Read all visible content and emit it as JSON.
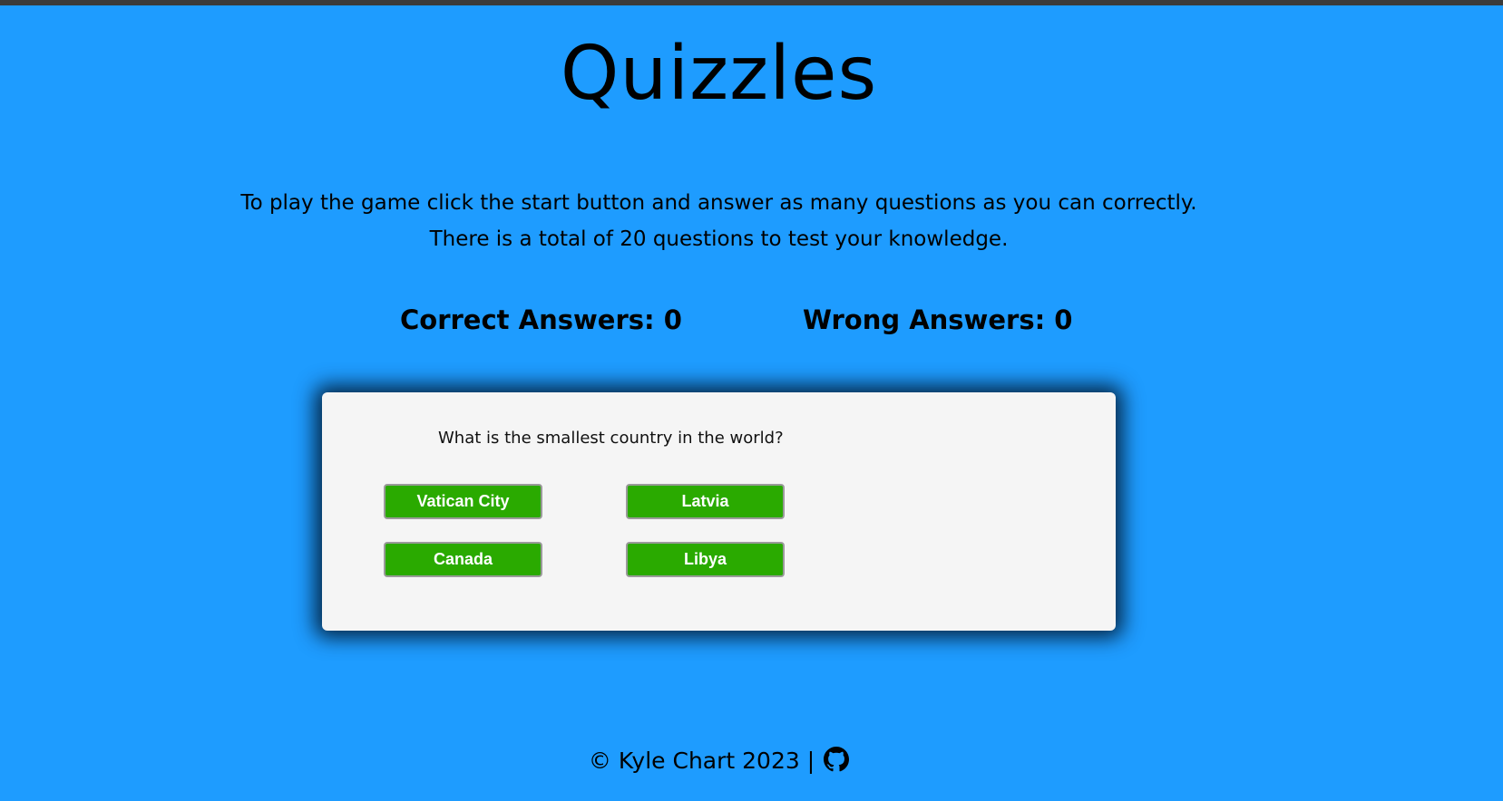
{
  "app": {
    "title": "Quizzles"
  },
  "instructions": {
    "line1": "To play the game click the start button and answer as many questions as you can correctly.",
    "line2": "There is a total of 20 questions to test your knowledge."
  },
  "scores": {
    "correct_label": "Correct Answers: 0",
    "wrong_label": "Wrong Answers: 0",
    "correct_count": 0,
    "wrong_count": 0
  },
  "quiz": {
    "question": "What is the smallest country in the world?",
    "answers": [
      "Vatican City",
      "Latvia",
      "Canada",
      "Libya"
    ]
  },
  "footer": {
    "copyright": "© Kyle Chart 2023 |",
    "link_icon": "github-icon"
  },
  "colors": {
    "background": "#1e9cff",
    "card": "#f5f5f5",
    "answer_button": "#2aaa00",
    "answer_text": "#ffffff"
  }
}
